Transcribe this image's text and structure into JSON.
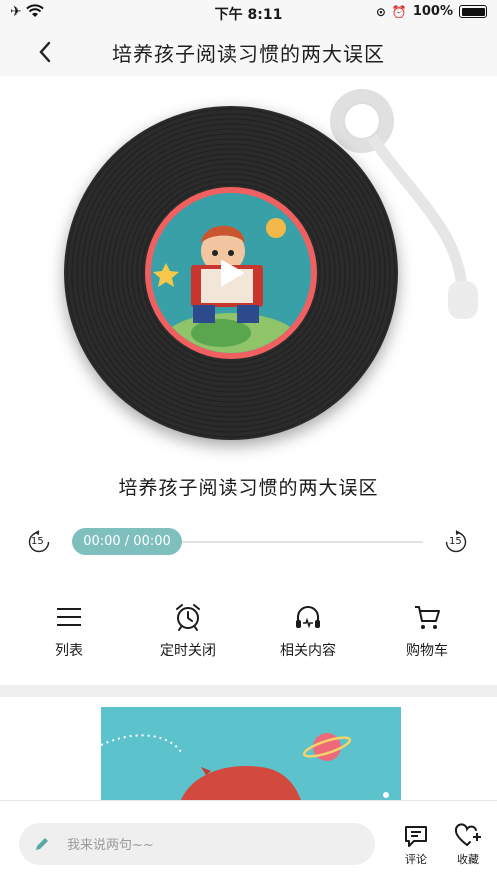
{
  "status_bar": {
    "time": "下午 8:11",
    "battery": "100%"
  },
  "nav": {
    "title": "培养孩子阅读习惯的两大误区"
  },
  "player": {
    "track_title": "培养孩子阅读习惯的两大误区",
    "time_display": "00:00 / 00:00",
    "progress": 0,
    "skip_back_label": "15",
    "skip_forward_label": "15",
    "accent_color": "#7fbfbe",
    "label_ring_color": "#f06060"
  },
  "actions": [
    {
      "label": "列表",
      "icon": "list-icon"
    },
    {
      "label": "定时关闭",
      "icon": "alarm-clock-icon"
    },
    {
      "label": "相关内容",
      "icon": "headphones-icon"
    },
    {
      "label": "购物车",
      "icon": "cart-icon"
    }
  ],
  "bottom_bar": {
    "comment_placeholder": "我来说两句~~",
    "comment_label": "评论",
    "favorite_label": "收藏"
  }
}
